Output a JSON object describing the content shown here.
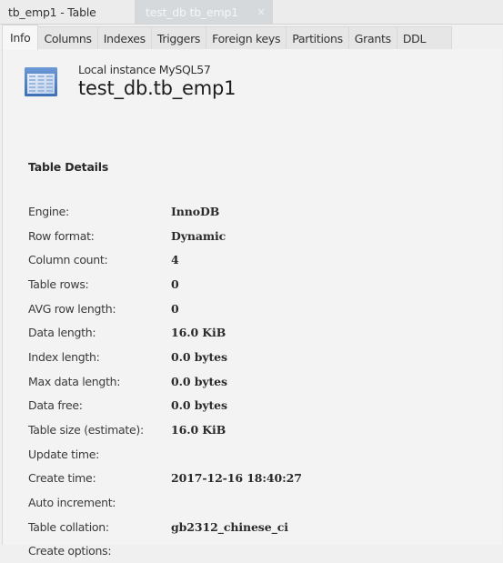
{
  "document_tabs": [
    {
      "label": "tb_emp1 - Table",
      "active": true
    },
    {
      "label": "test_db tb_emp1",
      "active": false,
      "close_icon": "×"
    }
  ],
  "subtabs": [
    {
      "label": "Info",
      "active": true
    },
    {
      "label": "Columns"
    },
    {
      "label": "Indexes"
    },
    {
      "label": "Triggers"
    },
    {
      "label": "Foreign keys"
    },
    {
      "label": "Partitions"
    },
    {
      "label": "Grants"
    },
    {
      "label": "DDL"
    }
  ],
  "header": {
    "icon": "table-icon",
    "instance": "Local instance MySQL57",
    "title": "test_db.tb_emp1"
  },
  "section_title": "Table Details",
  "details": [
    {
      "label": "Engine:",
      "value": "InnoDB"
    },
    {
      "label": "Row format:",
      "value": "Dynamic"
    },
    {
      "label": "Column count:",
      "value": "4"
    },
    {
      "label": "Table rows:",
      "value": "0"
    },
    {
      "label": "AVG row length:",
      "value": "0"
    },
    {
      "label": "Data length:",
      "value": "16.0 KiB"
    },
    {
      "label": "Index length:",
      "value": "0.0 bytes"
    },
    {
      "label": "Max data length:",
      "value": "0.0 bytes"
    },
    {
      "label": "Data free:",
      "value": "0.0 bytes"
    },
    {
      "label": "Table size (estimate):",
      "value": "16.0 KiB"
    },
    {
      "label": "Update time:",
      "value": ""
    },
    {
      "label": "Create time:",
      "value": "2017-12-16 18:40:27"
    },
    {
      "label": "Auto increment:",
      "value": ""
    },
    {
      "label": "Table collation:",
      "value": "gb2312_chinese_ci"
    },
    {
      "label": "Create options:",
      "value": ""
    }
  ],
  "colors": {
    "background": "#f3f3f3",
    "inactive_tab": "#d6d9dc",
    "icon_blue": "#4f7fc4"
  }
}
